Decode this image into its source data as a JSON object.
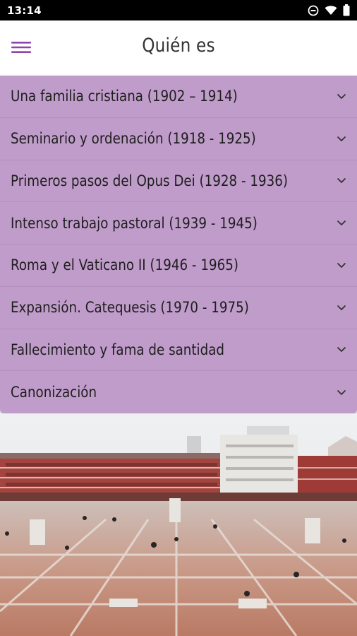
{
  "status_bar": {
    "time": "13:14",
    "icons": [
      "do-not-disturb-icon",
      "wifi-icon",
      "battery-icon"
    ]
  },
  "header": {
    "title": "Quién es",
    "menu_icon": "hamburger-menu-icon"
  },
  "colors": {
    "accent": "#8e44ad",
    "accordion_bg": "#c09cca",
    "title_text": "#333333",
    "item_text": "#1e1e1e"
  },
  "sections": [
    {
      "label": "Una familia cristiana (1902 – 1914)"
    },
    {
      "label": "Seminario y ordenación (1918 - 1925)"
    },
    {
      "label": "Primeros pasos del Opus Dei (1928 - 1936)"
    },
    {
      "label": "Intenso trabajo pastoral (1939 - 1945)"
    },
    {
      "label": "Roma y el Vaticano II (1946 - 1965)"
    },
    {
      "label": "Expansión. Catequesis (1970 - 1975)"
    },
    {
      "label": "Fallecimiento y fama de santidad"
    },
    {
      "label": "Canonización"
    }
  ],
  "photo": {
    "subject": "town-square-photo"
  }
}
